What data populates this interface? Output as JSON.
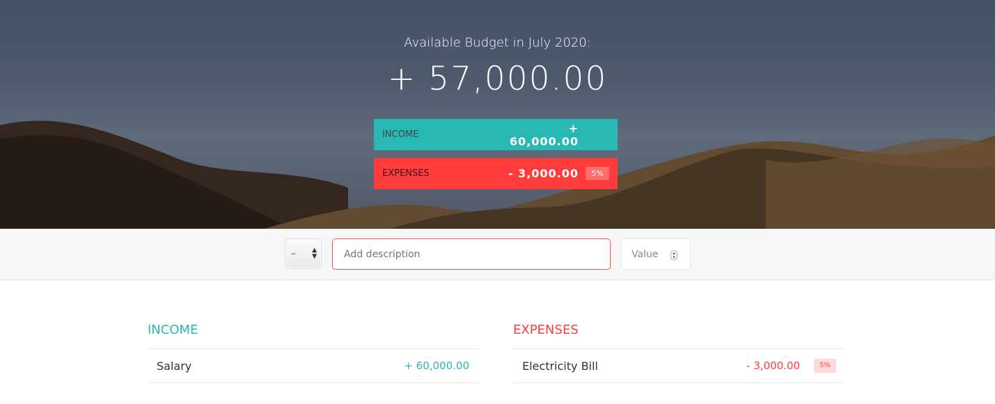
{
  "header": {
    "title": "Available Budget in July 2020:",
    "budget": "+ 57,000.00",
    "income": {
      "label": "INCOME",
      "value": "+ 60,000.00"
    },
    "expenses": {
      "label": "EXPENSES",
      "value": "- 3,000.00",
      "percentage": "5%"
    }
  },
  "add": {
    "type_value": "–",
    "description_placeholder": "Add description",
    "value_placeholder": "Value"
  },
  "income": {
    "title": "INCOME",
    "items": [
      {
        "description": "Salary",
        "value": "+ 60,000.00"
      }
    ]
  },
  "expenses": {
    "title": "EXPENSES",
    "items": [
      {
        "description": "Electricity Bill",
        "value": "- 3,000.00",
        "percentage": "5%"
      }
    ]
  },
  "colors": {
    "income": "#28b9b5",
    "expenses": "#ff3b3b",
    "input_focus": "#ff5049"
  }
}
